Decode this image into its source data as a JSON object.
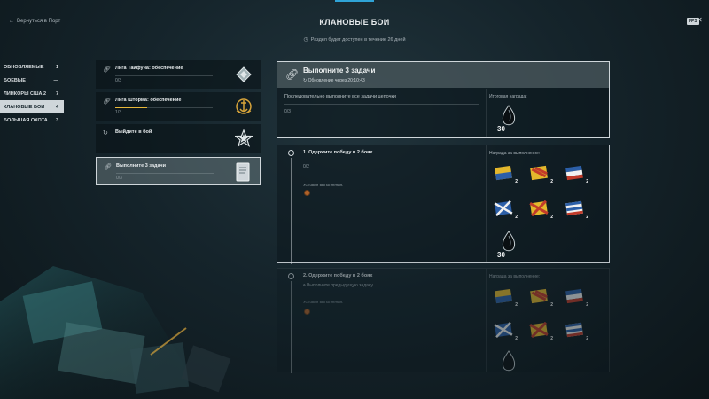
{
  "header": {
    "back_label": "Вернуться в Порт",
    "title": "КЛАНОВЫЕ БОИ",
    "fps_badge": "FPS",
    "close_glyph": "✕",
    "availability": "Раздел будет доступен в течение 26 дней"
  },
  "sidebar": {
    "items": [
      {
        "label": "ОБНОВЛЯЕМЫЕ",
        "count": "1",
        "active": false
      },
      {
        "label": "БОЕВЫЕ",
        "count": "—",
        "active": false
      },
      {
        "label": "ЛИНКОРЫ США 2",
        "count": "7",
        "active": false
      },
      {
        "label": "КЛАНОВЫЕ БОИ",
        "count": "4",
        "active": true
      },
      {
        "label": "БОЛЬШАЯ ОХОТА",
        "count": "3",
        "active": false
      }
    ]
  },
  "tasks": [
    {
      "icon": "chain-link-icon",
      "name": "Лига Тайфуна: обеспечение",
      "progress": "0/3",
      "progress_fraction": 0,
      "emblem": "typhoon-league-emblem"
    },
    {
      "icon": "chain-link-icon",
      "name": "Лига Шторма: обеспечение",
      "progress": "1/3",
      "progress_fraction": 0.33,
      "emblem": "storm-league-emblem"
    },
    {
      "icon": "refresh-icon",
      "name": "Выйдите в бой",
      "progress": "",
      "progress_fraction": 0,
      "emblem": "star-emblem"
    },
    {
      "icon": "chain-link-icon",
      "name": "Выполните 3 задачи",
      "progress": "0/3",
      "progress_fraction": 0,
      "emblem": "document-emblem",
      "selected": true
    }
  ],
  "detail": {
    "title": "Выполните 3 задачи",
    "update_prefix": "Обновление через",
    "update_time": "20:10:43",
    "description": "Последовательно выполните все задачи цепочки",
    "progress": "0/3",
    "reward_label": "Итоговая награда:",
    "reward_amount": "30"
  },
  "steps": [
    {
      "name": "1. Одержите победу в 2 боях",
      "progress": "0/2",
      "conditions_label": "Условия выполнения:",
      "reward_label": "Награда за выполнение:",
      "flags": [
        {
          "name": "yellow-blue-flag",
          "count": "2"
        },
        {
          "name": "red-yellow-striped-flag",
          "count": "2"
        },
        {
          "name": "blue-white-red-flag",
          "count": "2"
        },
        {
          "name": "blue-white-cross-flag",
          "count": "2"
        },
        {
          "name": "red-yellow-cross-flag",
          "count": "2"
        },
        {
          "name": "blue-white-stripes-flag",
          "count": "2"
        }
      ],
      "coal_amount": "30"
    },
    {
      "name": "2. Одержите победу в 2 боях",
      "lock_text": "Выполните предыдущую задачу",
      "conditions_label": "Условия выполнения:",
      "reward_label": "Награда за выполнение:",
      "flags": [
        {
          "name": "yellow-blue-flag",
          "count": "2"
        },
        {
          "name": "red-yellow-striped-flag",
          "count": "2"
        },
        {
          "name": "blue-white-red-flag",
          "count": "2"
        },
        {
          "name": "blue-white-cross-flag",
          "count": "2"
        },
        {
          "name": "red-yellow-cross-flag",
          "count": "2"
        },
        {
          "name": "blue-white-stripes-flag",
          "count": "2"
        }
      ]
    }
  ],
  "colors": {
    "accent": "#2fa3d6",
    "progress_gold": "#e8b839",
    "panel_border": "#cfd6da"
  }
}
